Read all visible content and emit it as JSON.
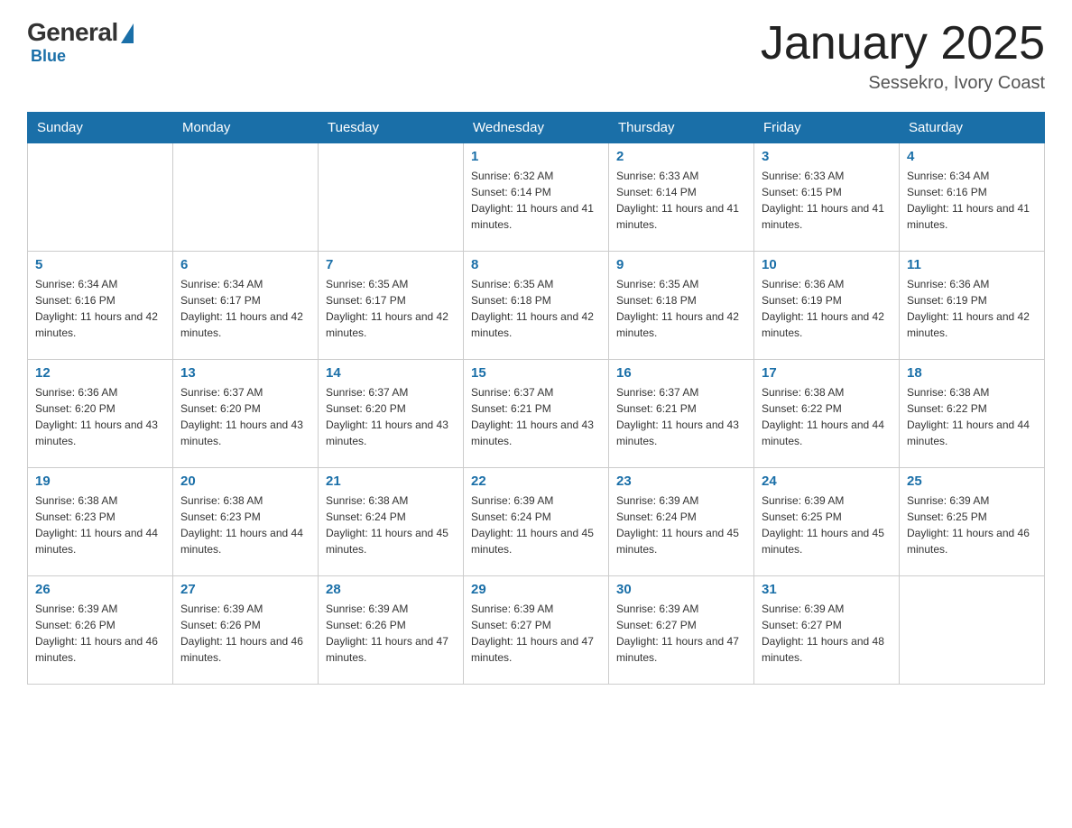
{
  "header": {
    "logo_general": "General",
    "logo_blue": "Blue",
    "month_title": "January 2025",
    "location": "Sessekro, Ivory Coast"
  },
  "days_of_week": [
    "Sunday",
    "Monday",
    "Tuesday",
    "Wednesday",
    "Thursday",
    "Friday",
    "Saturday"
  ],
  "weeks": [
    [
      {
        "day": "",
        "info": ""
      },
      {
        "day": "",
        "info": ""
      },
      {
        "day": "",
        "info": ""
      },
      {
        "day": "1",
        "info": "Sunrise: 6:32 AM\nSunset: 6:14 PM\nDaylight: 11 hours and 41 minutes."
      },
      {
        "day": "2",
        "info": "Sunrise: 6:33 AM\nSunset: 6:14 PM\nDaylight: 11 hours and 41 minutes."
      },
      {
        "day": "3",
        "info": "Sunrise: 6:33 AM\nSunset: 6:15 PM\nDaylight: 11 hours and 41 minutes."
      },
      {
        "day": "4",
        "info": "Sunrise: 6:34 AM\nSunset: 6:16 PM\nDaylight: 11 hours and 41 minutes."
      }
    ],
    [
      {
        "day": "5",
        "info": "Sunrise: 6:34 AM\nSunset: 6:16 PM\nDaylight: 11 hours and 42 minutes."
      },
      {
        "day": "6",
        "info": "Sunrise: 6:34 AM\nSunset: 6:17 PM\nDaylight: 11 hours and 42 minutes."
      },
      {
        "day": "7",
        "info": "Sunrise: 6:35 AM\nSunset: 6:17 PM\nDaylight: 11 hours and 42 minutes."
      },
      {
        "day": "8",
        "info": "Sunrise: 6:35 AM\nSunset: 6:18 PM\nDaylight: 11 hours and 42 minutes."
      },
      {
        "day": "9",
        "info": "Sunrise: 6:35 AM\nSunset: 6:18 PM\nDaylight: 11 hours and 42 minutes."
      },
      {
        "day": "10",
        "info": "Sunrise: 6:36 AM\nSunset: 6:19 PM\nDaylight: 11 hours and 42 minutes."
      },
      {
        "day": "11",
        "info": "Sunrise: 6:36 AM\nSunset: 6:19 PM\nDaylight: 11 hours and 42 minutes."
      }
    ],
    [
      {
        "day": "12",
        "info": "Sunrise: 6:36 AM\nSunset: 6:20 PM\nDaylight: 11 hours and 43 minutes."
      },
      {
        "day": "13",
        "info": "Sunrise: 6:37 AM\nSunset: 6:20 PM\nDaylight: 11 hours and 43 minutes."
      },
      {
        "day": "14",
        "info": "Sunrise: 6:37 AM\nSunset: 6:20 PM\nDaylight: 11 hours and 43 minutes."
      },
      {
        "day": "15",
        "info": "Sunrise: 6:37 AM\nSunset: 6:21 PM\nDaylight: 11 hours and 43 minutes."
      },
      {
        "day": "16",
        "info": "Sunrise: 6:37 AM\nSunset: 6:21 PM\nDaylight: 11 hours and 43 minutes."
      },
      {
        "day": "17",
        "info": "Sunrise: 6:38 AM\nSunset: 6:22 PM\nDaylight: 11 hours and 44 minutes."
      },
      {
        "day": "18",
        "info": "Sunrise: 6:38 AM\nSunset: 6:22 PM\nDaylight: 11 hours and 44 minutes."
      }
    ],
    [
      {
        "day": "19",
        "info": "Sunrise: 6:38 AM\nSunset: 6:23 PM\nDaylight: 11 hours and 44 minutes."
      },
      {
        "day": "20",
        "info": "Sunrise: 6:38 AM\nSunset: 6:23 PM\nDaylight: 11 hours and 44 minutes."
      },
      {
        "day": "21",
        "info": "Sunrise: 6:38 AM\nSunset: 6:24 PM\nDaylight: 11 hours and 45 minutes."
      },
      {
        "day": "22",
        "info": "Sunrise: 6:39 AM\nSunset: 6:24 PM\nDaylight: 11 hours and 45 minutes."
      },
      {
        "day": "23",
        "info": "Sunrise: 6:39 AM\nSunset: 6:24 PM\nDaylight: 11 hours and 45 minutes."
      },
      {
        "day": "24",
        "info": "Sunrise: 6:39 AM\nSunset: 6:25 PM\nDaylight: 11 hours and 45 minutes."
      },
      {
        "day": "25",
        "info": "Sunrise: 6:39 AM\nSunset: 6:25 PM\nDaylight: 11 hours and 46 minutes."
      }
    ],
    [
      {
        "day": "26",
        "info": "Sunrise: 6:39 AM\nSunset: 6:26 PM\nDaylight: 11 hours and 46 minutes."
      },
      {
        "day": "27",
        "info": "Sunrise: 6:39 AM\nSunset: 6:26 PM\nDaylight: 11 hours and 46 minutes."
      },
      {
        "day": "28",
        "info": "Sunrise: 6:39 AM\nSunset: 6:26 PM\nDaylight: 11 hours and 47 minutes."
      },
      {
        "day": "29",
        "info": "Sunrise: 6:39 AM\nSunset: 6:27 PM\nDaylight: 11 hours and 47 minutes."
      },
      {
        "day": "30",
        "info": "Sunrise: 6:39 AM\nSunset: 6:27 PM\nDaylight: 11 hours and 47 minutes."
      },
      {
        "day": "31",
        "info": "Sunrise: 6:39 AM\nSunset: 6:27 PM\nDaylight: 11 hours and 48 minutes."
      },
      {
        "day": "",
        "info": ""
      }
    ]
  ]
}
